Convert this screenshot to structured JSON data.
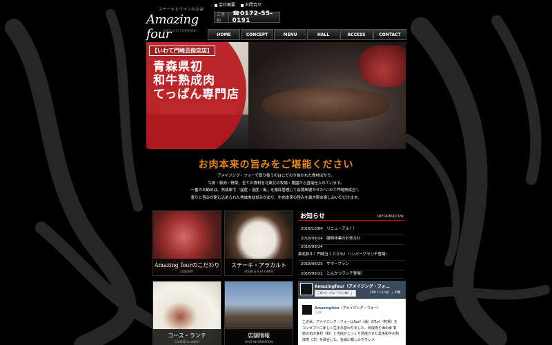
{
  "header": {
    "logo_small": "ステーキとワインのお店",
    "logo_main": "Amazing four",
    "logo_sub": "SINCE 2011 TEPPANYAKI",
    "top_links": [
      "会社概要",
      "お問合せ"
    ],
    "phone_prefix": "ご予約",
    "phone_number": "☎0172-55-0191"
  },
  "nav": [
    {
      "label": "HOME"
    },
    {
      "label": "CONCEPT"
    },
    {
      "label": "MENU"
    },
    {
      "label": "HALL"
    },
    {
      "label": "ACCESS"
    },
    {
      "label": "CONTACT"
    }
  ],
  "hero": {
    "tag": "【いわて門崎丑指定店】",
    "lines": [
      "青森県初",
      "和牛熟成肉",
      "てっぱん専門店"
    ]
  },
  "headline": "お肉本来の旨みをご堪能ください",
  "intro": [
    "アメイジング・フォーで取り扱うのはこだわり抜かれた食材ばかり。",
    "牛肉・豚肉・野菜、全ての食材を北東北の牧場・農園から直接仕入れています。",
    "一番のお勧めは、熟成庫で「温度・湿度・風」を徹底管理して長期間寝かせた\"いわて門崎熟成丑\"。",
    "香りと旨みが閉じ込められた熟成肉は甘みがあり、牛肉本来の旨みを最大限お楽しみいただけます。"
  ],
  "tiles": [
    {
      "title": "Amazing fourのこだわり",
      "sub": "CONCEPT"
    },
    {
      "title": "ステーキ・アラカルト",
      "sub": "STEAK & A LA CARTE"
    },
    {
      "title": "コース・ランチ",
      "sub": "COURSE & LUNCH"
    },
    {
      "title": "店舗情報",
      "sub": "SHOP INFORMATION"
    }
  ],
  "news": {
    "title": "お知らせ",
    "title_en": "INFORMATION",
    "items": [
      {
        "text": "2018/10/04　リニューアル！！"
      },
      {
        "text": "2018/09/24　臨時休業のお知らせ"
      },
      {
        "text": "2018/08/24"
      },
      {
        "text": "黒毛和牛！門崎丑１００％！ハンバーグランチ登場！"
      },
      {
        "text": "2018/06/25　サマープラン"
      },
      {
        "text": "2018/06/22　とんかつランチ登場！"
      }
    ]
  },
  "facebook": {
    "page_name": "Amazingfour（アメイジング・フォ…",
    "like_label": "このページに「いいね！」",
    "like_count": "298「いいね！」の数",
    "post_name": "Amazingfour（アメイジング・フォー）",
    "post_time": "3日前",
    "post_text": "この秋、アメイジング・フォーはSurf（海）&Turf（牧場）をコンセプトに新しく生まれ変わりました。熟成肉と海の幸 季節の旬の食材（和）と当店がじっくり熟成させた黒毛和牛の熟成肉（洋）を融合した、皆様に親しみやすいメ"
  }
}
